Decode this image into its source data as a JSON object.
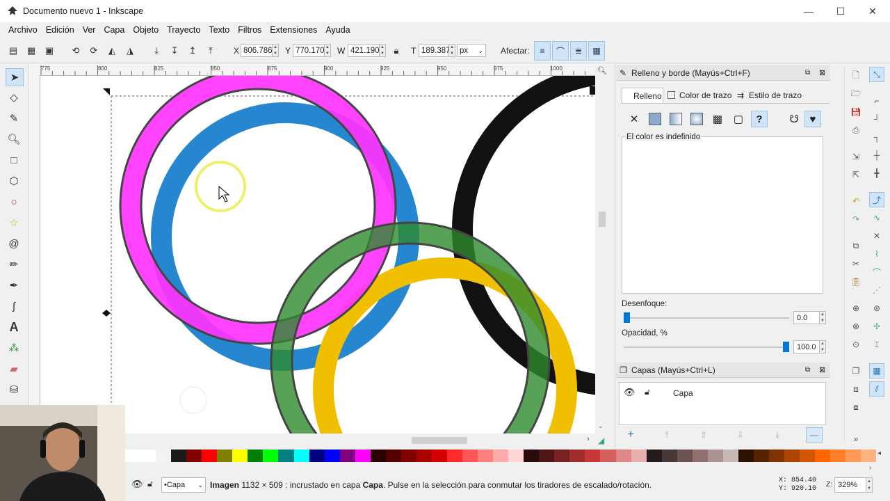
{
  "window": {
    "title": "Documento nuevo 1 - Inkscape",
    "minimize": "—",
    "maximize": "☐",
    "close": "✕"
  },
  "menu": [
    "Archivo",
    "Edición",
    "Ver",
    "Capa",
    "Objeto",
    "Trayecto",
    "Texto",
    "Filtros",
    "Extensiones",
    "Ayuda"
  ],
  "toolbar": {
    "x_label": "X",
    "x_value": "806.786",
    "y_label": "Y",
    "y_value": "770.170",
    "w_label": "W",
    "w_value": "421.190",
    "h_label": "T",
    "h_value": "189.387",
    "unit": "px",
    "affect_label": "Afectar:"
  },
  "ruler": {
    "h_ticks": [
      "775",
      "800",
      "825",
      "850",
      "875",
      "900",
      "925",
      "950",
      "975",
      "1000"
    ]
  },
  "fill_stroke_panel": {
    "title": "Relleno y borde (Mayús+Ctrl+F)",
    "tabs": [
      "Relleno",
      "Color de trazo",
      "Estilo de trazo"
    ],
    "undefined_color": "El color es indefinido",
    "blur_label": "Desenfoque:",
    "blur_value": "0.0",
    "blur_level": 0.0,
    "opacity_label": "Opacidad, %",
    "opacity_value": "100.0",
    "opacity_level": 1.0
  },
  "layers_panel": {
    "title": "Capas (Mayús+Ctrl+L)",
    "layer_name": "Capa"
  },
  "status": {
    "layer_dropdown": "•Capa",
    "message_bold": "Imagen",
    "message_size": " 1132 × 509 : incrustado en capa ",
    "message_layer": "Capa",
    "message_rest": ". Pulse en la selección para conmutar los tiradores de escalado/rotación.",
    "cursor_x": "X: 854.40",
    "cursor_y": "Y: 920.10",
    "zoom_label": "Z:",
    "zoom_value": "329%"
  },
  "colors": {
    "accent": "#0078d7",
    "magenta": "#ff33ff",
    "blue": "#1a7fcc",
    "black": "#111111",
    "green": "#3a9a3a",
    "yellow": "#f0c000"
  },
  "palette": [
    "#ffffff",
    "#ffffff",
    "#f2f2f2",
    "#1a1a1a",
    "#800000",
    "#ff0000",
    "#808000",
    "#ffff00",
    "#008000",
    "#00ff00",
    "#008080",
    "#00ffff",
    "#000080",
    "#0000ff",
    "#800080",
    "#ff00ff",
    "#2b0000",
    "#550000",
    "#800000",
    "#aa0000",
    "#d40000",
    "#ff2a2a",
    "#ff5555",
    "#ff8080",
    "#ffaaaa",
    "#ffd5d5",
    "#280b0b",
    "#501616",
    "#782121",
    "#a02c2c",
    "#c83737",
    "#d35f5f",
    "#de8787",
    "#e9afaf",
    "#241c1c",
    "#483737",
    "#6c5353",
    "#916f6f",
    "#ac9393",
    "#c8b7b7",
    "#2b1100",
    "#552200",
    "#803300",
    "#aa4400",
    "#d45500",
    "#ff6600",
    "#ff7f2a",
    "#ff9955",
    "#ffb380"
  ]
}
